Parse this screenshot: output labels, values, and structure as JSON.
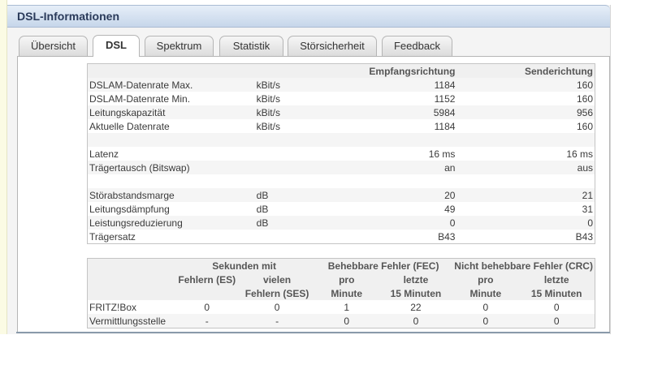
{
  "title": "DSL-Informationen",
  "tabs": [
    {
      "label": "Übersicht"
    },
    {
      "label": "DSL"
    },
    {
      "label": "Spektrum"
    },
    {
      "label": "Statistik"
    },
    {
      "label": "Störsicherheit"
    },
    {
      "label": "Feedback"
    }
  ],
  "active_tab": "DSL",
  "rates_table": {
    "headers": {
      "col1": "",
      "col2": "",
      "empfang": "Empfangsrichtung",
      "sende": "Senderichtung"
    },
    "rows": [
      {
        "label": "DSLAM-Datenrate Max.",
        "unit": "kBit/s",
        "empfang": "1184",
        "sende": "160"
      },
      {
        "label": "DSLAM-Datenrate Min.",
        "unit": "kBit/s",
        "empfang": "1152",
        "sende": "160"
      },
      {
        "label": "Leitungskapazität",
        "unit": "kBit/s",
        "empfang": "5984",
        "sende": "956"
      },
      {
        "label": "Aktuelle Datenrate",
        "unit": "kBit/s",
        "empfang": "1184",
        "sende": "160"
      },
      {
        "label": "",
        "unit": "",
        "empfang": "",
        "sende": ""
      },
      {
        "label": "Latenz",
        "unit": "",
        "empfang": "16 ms",
        "sende": "16 ms"
      },
      {
        "label": "Trägertausch (Bitswap)",
        "unit": "",
        "empfang": "an",
        "sende": "aus"
      },
      {
        "label": "",
        "unit": "",
        "empfang": "",
        "sende": ""
      },
      {
        "label": "Störabstandsmarge",
        "unit": "dB",
        "empfang": "20",
        "sende": "21"
      },
      {
        "label": "Leitungsdämpfung",
        "unit": "dB",
        "empfang": "49",
        "sende": "31"
      },
      {
        "label": "Leistungsreduzierung",
        "unit": "dB",
        "empfang": "0",
        "sende": "0"
      },
      {
        "label": "Trägersatz",
        "unit": "",
        "empfang": "B43",
        "sende": "B43"
      }
    ]
  },
  "errors_table": {
    "group_headers": {
      "sekunden": "Sekunden mit",
      "fec": "Behebbare Fehler (FEC)",
      "crc": "Nicht behebbare Fehler (CRC)"
    },
    "sub_headers": {
      "es_line1": "Fehlern (ES)",
      "ses_line1": "vielen",
      "ses_line2": "Fehlern (SES)",
      "fec_min_line1": "pro",
      "fec_min_line2": "Minute",
      "fec_15_line1": "letzte",
      "fec_15_line2": "15 Minuten",
      "crc_min_line1": "pro",
      "crc_min_line2": "Minute",
      "crc_15_line1": "letzte",
      "crc_15_line2": "15 Minuten"
    },
    "rows": [
      {
        "label": "FRITZ!Box",
        "es": "0",
        "ses": "0",
        "fec_min": "1",
        "fec_15": "22",
        "crc_min": "0",
        "crc_15": "0"
      },
      {
        "label": "Vermittlungsstelle",
        "es": "-",
        "ses": "-",
        "fec_min": "0",
        "fec_15": "0",
        "crc_min": "0",
        "crc_15": "0"
      }
    ]
  }
}
